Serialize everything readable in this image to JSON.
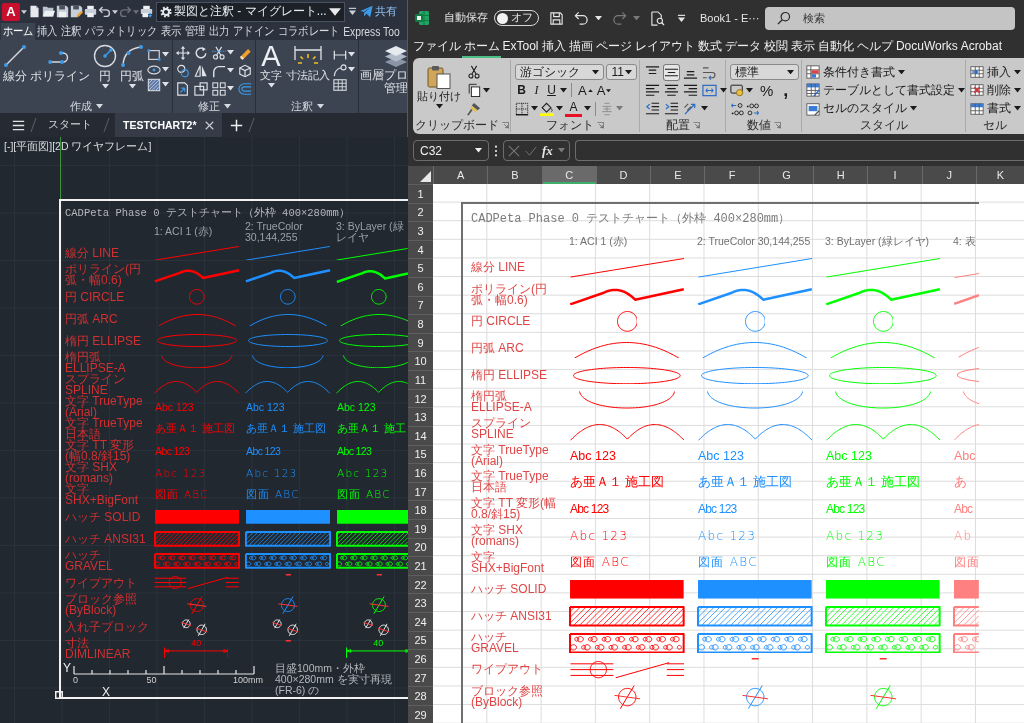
{
  "autocad": {
    "title_bar": {
      "logo": "A",
      "workspace": "製図と注釈 - マイグレート...",
      "redo": {
        "disabled": true
      },
      "share": "共有"
    },
    "ribbon_tabs": [
      {
        "label": "ホーム",
        "selected": true
      },
      {
        "label": "挿入",
        "selected": false
      },
      {
        "label": "注釈",
        "selected": false
      },
      {
        "label": "パラメトリック",
        "selected": false
      },
      {
        "label": "表示",
        "selected": false
      },
      {
        "label": "管理",
        "selected": false
      },
      {
        "label": "出力",
        "selected": false
      },
      {
        "label": "アドイン",
        "selected": false
      },
      {
        "label": "コラボレート",
        "selected": false
      },
      {
        "label": "Express Too",
        "selected": false
      }
    ],
    "create_panel": {
      "title": "作成",
      "buttons": [
        "線分",
        "ポリライン",
        "円",
        "円弧"
      ]
    },
    "modify_panel": {
      "title": "修正"
    },
    "annotate_panel": {
      "title": "注釈",
      "text_button": {
        "glyph": "A",
        "label": "文字"
      },
      "dimension_button": "寸法記入"
    },
    "layer_panel": {
      "button_lines": [
        "画層プロ",
        "管理"
      ]
    },
    "file_tabs": [
      {
        "label": "スタート",
        "selected": false
      },
      {
        "label": "TESTCHART2*",
        "selected": true
      }
    ],
    "viewport_label": "[-][平面図][2D ワイヤフレーム]",
    "drawing": {
      "title": "CADPeta Phase 0 テストチャート（外枠 400×280mm）",
      "columns": [
        {
          "header": "1: ACI 1 (赤)",
          "color": "#ff0000"
        },
        {
          "header": "2: TrueColor 30,144,255",
          "color": "#1e90ff"
        },
        {
          "header": "3: ByLayer (緑レイヤ",
          "color": "#00ff00"
        }
      ],
      "rows": [
        {
          "kind": "line",
          "label": "線分 LINE"
        },
        {
          "kind": "polyline",
          "label": "ポリライン(円弧・幅0.6)"
        },
        {
          "kind": "circle",
          "label": "円 CIRCLE"
        },
        {
          "kind": "arc",
          "label": "円弧 ARC"
        },
        {
          "kind": "ellipse",
          "label": "楕円 ELLIPSE"
        },
        {
          "kind": "ellipticarc",
          "label": "楕円弧 ELLIPSE-A"
        },
        {
          "kind": "spline",
          "label": "スプライン SPLINE"
        },
        {
          "kind": "truetype",
          "label": "文字 TrueType (Arial)",
          "cells": [
            "Abc 123",
            "Abc 123",
            "Abc 123"
          ]
        },
        {
          "kind": "truetype",
          "label": "文字 TrueType 日本語",
          "cells": [
            "あ亜Ａ１ 施工図",
            "あ亜Ａ１ 施工図",
            "あ亜Ａ１ 施工"
          ]
        },
        {
          "kind": "condensed",
          "label": "文字 TT 変形(幅0.8/斜15)",
          "cells": [
            "Abc 123",
            "Abc 123",
            "Abc 123"
          ]
        },
        {
          "kind": "shx",
          "label": "文字 SHX (romans)",
          "cells": [
            "Abc 123",
            "Abc 123",
            "Abc 123"
          ]
        },
        {
          "kind": "shx",
          "label": "文字 SHX+BigFont",
          "cells": [
            "図面 ABC",
            "図面 ABC",
            "図面 ABC"
          ]
        },
        {
          "kind": "solid",
          "label": "ハッチ SOLID"
        },
        {
          "kind": "ansi31",
          "label": "ハッチ ANSI31"
        },
        {
          "kind": "gravel",
          "label": "ハッチ GRAVEL"
        },
        {
          "kind": "wipeout",
          "label": "ワイプアウト",
          "cells": [
            {
              "covered": false
            },
            {
              "covered": true
            },
            {
              "covered": true
            }
          ]
        },
        {
          "kind": "block",
          "label": "ブロック参照 (ByBlock)"
        },
        {
          "kind": "nested",
          "label": "入れ子ブロック"
        },
        {
          "kind": "dimension",
          "label": "寸法 DIMLINEAR",
          "cells": [
            {
              "text": "40",
              "covered": false
            },
            {
              "covered": true
            },
            {
              "text": "40",
              "covered": false
            }
          ]
        }
      ],
      "scale_labels": [
        "0",
        "50",
        "100mm"
      ],
      "note": "目盛100mm・外枠400×280mm を実寸再現 (FR-6) の",
      "ucs": {
        "x": "X",
        "y": "Y"
      }
    }
  },
  "excel": {
    "title_bar": {
      "autosave_label": "自動保存",
      "autosave": {
        "on": false,
        "label": "オフ"
      },
      "redo": {
        "disabled": true
      },
      "title": "Book1 - E···",
      "search": {
        "placeholder": "検索"
      }
    },
    "tabs": [
      {
        "label": "ファイル",
        "selected": false
      },
      {
        "label": "ホーム",
        "selected": true
      },
      {
        "label": "ExTool",
        "selected": false
      },
      {
        "label": "挿入",
        "selected": false
      },
      {
        "label": "描画",
        "selected": false
      },
      {
        "label": "ページ レイアウト",
        "selected": false
      },
      {
        "label": "数式",
        "selected": false
      },
      {
        "label": "データ",
        "selected": false
      },
      {
        "label": "校閲",
        "selected": false
      },
      {
        "label": "表示",
        "selected": false
      },
      {
        "label": "自動化",
        "selected": false
      },
      {
        "label": "ヘルプ",
        "selected": false
      },
      {
        "label": "DocuWorks",
        "selected": false
      },
      {
        "label": "Acrobat",
        "selected": false
      }
    ],
    "ribbon": {
      "clipboard": {
        "title": "クリップボード",
        "paste": "貼り付け"
      },
      "font": {
        "title": "フォント",
        "family": "游ゴシック",
        "size": "11",
        "styles": [
          "B",
          "I",
          "U"
        ],
        "grow": "A",
        "shrink": "A",
        "font_color": "A"
      },
      "alignment": {
        "title": "配置",
        "vertical": [
          {
            "selected": false
          },
          {
            "selected": true
          },
          {
            "selected": false
          }
        ]
      },
      "number": {
        "title": "数値",
        "format": "標準",
        "percent": "%",
        "comma": ","
      },
      "styles": {
        "title": "スタイル",
        "items": [
          "条件付き書式",
          "テーブルとして書式設定",
          "セルのスタイル"
        ]
      },
      "cells": {
        "title": "セル",
        "items": [
          "挿入",
          "削除",
          "書式"
        ]
      }
    },
    "formula_bar": {
      "name_box": "C32",
      "editing": false,
      "fx": "fx"
    },
    "columns": [
      {
        "label": "A",
        "selected": false
      },
      {
        "label": "B",
        "selected": false
      },
      {
        "label": "C",
        "selected": true
      },
      {
        "label": "D",
        "selected": false
      },
      {
        "label": "E",
        "selected": false
      },
      {
        "label": "F",
        "selected": false
      },
      {
        "label": "G",
        "selected": false
      },
      {
        "label": "H",
        "selected": false
      },
      {
        "label": "I",
        "selected": false
      },
      {
        "label": "J",
        "selected": false
      },
      {
        "label": "K",
        "selected": false
      }
    ],
    "rows": [
      "1",
      "2",
      "3",
      "4",
      "5",
      "6",
      "7",
      "8",
      "9",
      "10",
      "11",
      "12",
      "13",
      "14",
      "15",
      "16",
      "17",
      "18",
      "19",
      "20",
      "21",
      "22",
      "23",
      "24",
      "25",
      "26",
      "27",
      "28",
      "29"
    ],
    "picture": {
      "title": "CADPeta Phase 0 テストチャート（外枠 400×280mm）",
      "columns": [
        {
          "header": "1: ACI 1 (赤)",
          "color": "#ff0000"
        },
        {
          "header": "2: TrueColor 30,144,255",
          "color": "#1e90ff"
        },
        {
          "header": "3: ByLayer (緑レイヤ)",
          "color": "#00ff00"
        },
        {
          "header": "4: 表",
          "color": "#ff8080"
        }
      ],
      "rows": [
        {
          "kind": "line",
          "label": "線分 LINE"
        },
        {
          "kind": "polyline",
          "label": "ポリライン(円弧・幅0.6)"
        },
        {
          "kind": "circle",
          "label": "円 CIRCLE"
        },
        {
          "kind": "arc",
          "label": "円弧 ARC"
        },
        {
          "kind": "ellipse",
          "label": "楕円 ELLIPSE"
        },
        {
          "kind": "ellipticarc",
          "label": "楕円弧 ELLIPSE-A"
        },
        {
          "kind": "spline",
          "label": "スプライン SPLINE"
        },
        {
          "kind": "truetype",
          "label": "文字 TrueType (Arial)",
          "cells": [
            "Abc 123",
            "Abc 123",
            "Abc 123",
            "Abc"
          ]
        },
        {
          "kind": "truetype",
          "label": "文字 TrueType 日本語",
          "cells": [
            "あ亜Ａ１ 施工図",
            "あ亜Ａ１ 施工図",
            "あ亜Ａ１ 施工図",
            "あ"
          ]
        },
        {
          "kind": "condensed",
          "label": "文字 TT 変形(幅0.8/斜15)",
          "cells": [
            "Abc 123",
            "Abc 123",
            "Abc 123",
            "Abc"
          ]
        },
        {
          "kind": "shx",
          "label": "文字 SHX (romans)",
          "cells": [
            "Abc 123",
            "Abc 123",
            "Abc 123",
            "Ab"
          ]
        },
        {
          "kind": "shx",
          "label": "文字 SHX+BigFont",
          "cells": [
            "図面 ABC",
            "図面 ABC",
            "図面 ABC",
            "図面"
          ]
        },
        {
          "kind": "solid",
          "label": "ハッチ SOLID"
        },
        {
          "kind": "ansi31",
          "label": "ハッチ ANSI31"
        },
        {
          "kind": "gravel",
          "label": "ハッチ GRAVEL"
        },
        {
          "kind": "wipeout",
          "label": "ワイプアウト",
          "cells": [
            {
              "covered": false
            },
            {
              "covered": true
            },
            {
              "covered": true
            }
          ]
        },
        {
          "kind": "block",
          "label": "ブロック参照 (ByBlock)"
        }
      ]
    }
  }
}
